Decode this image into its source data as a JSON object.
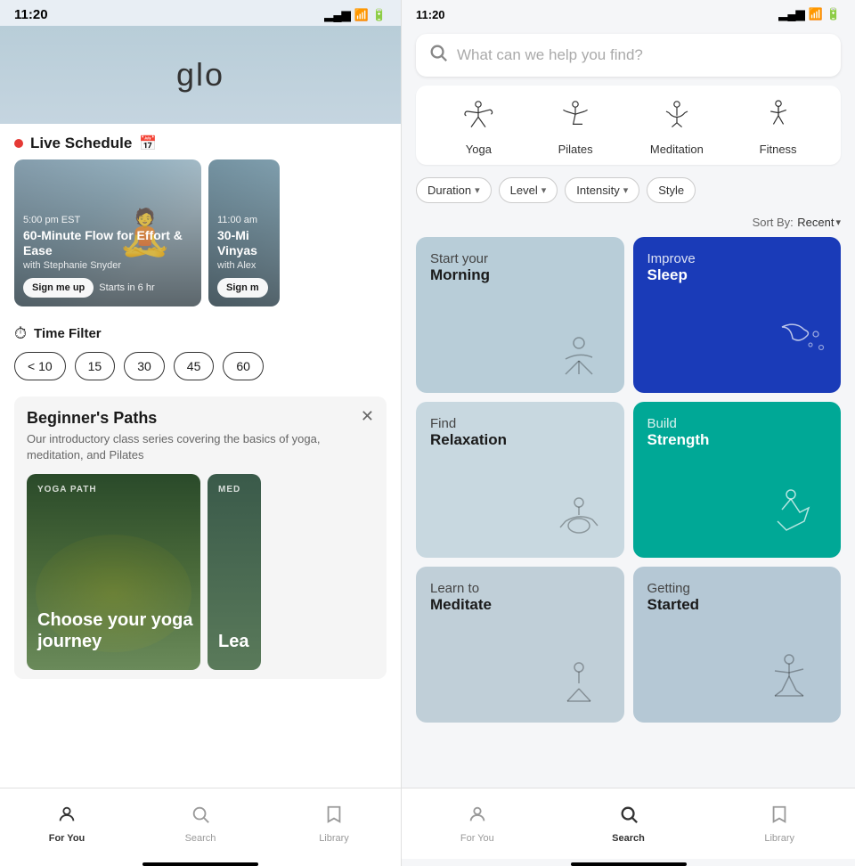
{
  "left": {
    "statusTime": "11:20",
    "logo": "glo",
    "liveSection": {
      "title": "Live Schedule",
      "card1": {
        "time": "5:00 pm EST",
        "title": "60-Minute Flow for Effort & Ease",
        "instructor": "with Stephanie Snyder",
        "btnLabel": "Sign me up",
        "startsIn": "Starts in 6 hr"
      },
      "card2": {
        "time": "11:00 am",
        "title": "30-Mi Vinyas",
        "instructor": "with Alex",
        "btnLabel": "Sign m"
      }
    },
    "timeFilter": {
      "title": "Time Filter",
      "options": [
        "< 10",
        "15",
        "30",
        "45",
        "60"
      ]
    },
    "beginnerPaths": {
      "title": "Beginner's Paths",
      "desc": "Our introductory class series covering the basics of yoga, meditation, and Pilates",
      "card1": {
        "label": "YOGA PATH",
        "title": "Choose your yoga journey"
      },
      "card2": {
        "label": "MED",
        "title": "Lea"
      }
    },
    "nav": {
      "items": [
        {
          "label": "For You",
          "active": true
        },
        {
          "label": "Search",
          "active": false
        },
        {
          "label": "Library",
          "active": false
        }
      ]
    }
  },
  "right": {
    "statusTime": "11:20",
    "search": {
      "placeholder": "What can we help you find?"
    },
    "categories": [
      {
        "label": "Yoga"
      },
      {
        "label": "Pilates"
      },
      {
        "label": "Meditation"
      },
      {
        "label": "Fitness"
      }
    ],
    "filters": [
      {
        "label": "Duration"
      },
      {
        "label": "Level"
      },
      {
        "label": "Intensity"
      },
      {
        "label": "Style"
      }
    ],
    "sort": {
      "prefix": "Sort By:",
      "value": "Recent"
    },
    "grid": [
      {
        "topLabel": "Start your",
        "title": "Morning",
        "bg": "light-blue"
      },
      {
        "topLabel": "Improve",
        "title": "Sleep",
        "bg": "blue"
      },
      {
        "topLabel": "Find",
        "title": "Relaxation",
        "bg": "light"
      },
      {
        "topLabel": "Build",
        "title": "Strength",
        "bg": "teal"
      },
      {
        "topLabel": "Learn to",
        "title": "Meditate",
        "bg": "light2"
      },
      {
        "topLabel": "Getting",
        "title": "Started",
        "bg": "light3"
      }
    ],
    "nav": {
      "items": [
        {
          "label": "For You",
          "active": false
        },
        {
          "label": "Search",
          "active": true
        },
        {
          "label": "Library",
          "active": false
        }
      ]
    }
  }
}
